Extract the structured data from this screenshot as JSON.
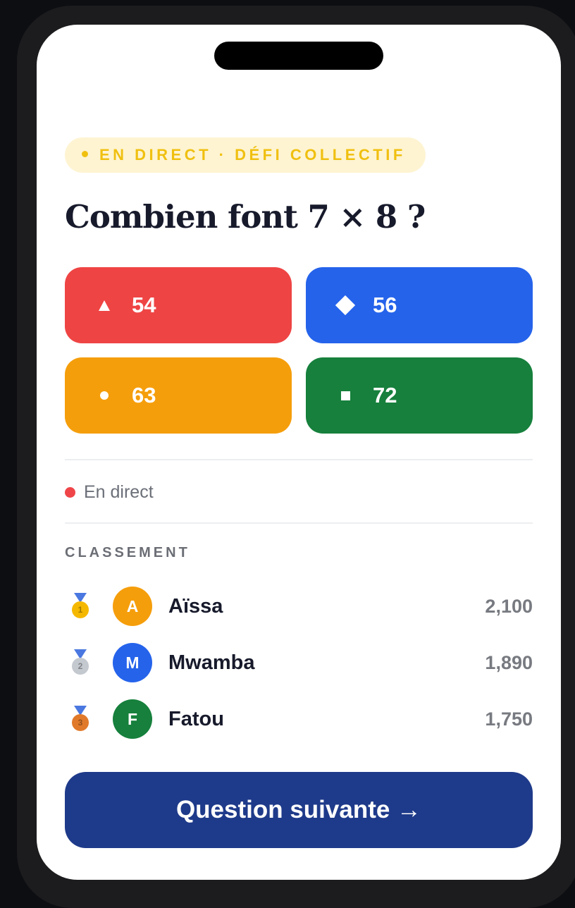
{
  "badge": {
    "text": "EN DIRECT · DÉFI COLLECTIF",
    "color": "#f0c010"
  },
  "question": {
    "text": "Combien font 7 × 8 ?"
  },
  "answers": [
    {
      "shape": "triangle-icon",
      "label": "54",
      "color": "#ef4444"
    },
    {
      "shape": "diamond-icon",
      "label": "56",
      "color": "#2563eb"
    },
    {
      "shape": "circle-icon",
      "label": "63",
      "color": "#f59e0b"
    },
    {
      "shape": "square-icon",
      "label": "72",
      "color": "#16803c"
    }
  ],
  "status": {
    "text": "En direct",
    "color": "#ef4549"
  },
  "leaderboard": {
    "title": "CLASSEMENT",
    "players": [
      {
        "rank": "1",
        "medal": "gold-medal-icon",
        "initial": "A",
        "name": "Aïssa",
        "score": "2,100",
        "avatar_color": "#f59e0b"
      },
      {
        "rank": "2",
        "medal": "silver-medal-icon",
        "initial": "M",
        "name": "Mwamba",
        "score": "1,890",
        "avatar_color": "#2563eb"
      },
      {
        "rank": "3",
        "medal": "bronze-medal-icon",
        "initial": "F",
        "name": "Fatou",
        "score": "1,750",
        "avatar_color": "#16803c"
      }
    ]
  },
  "next_button": {
    "label": "Question suivante →",
    "color": "#1e3a8a"
  }
}
